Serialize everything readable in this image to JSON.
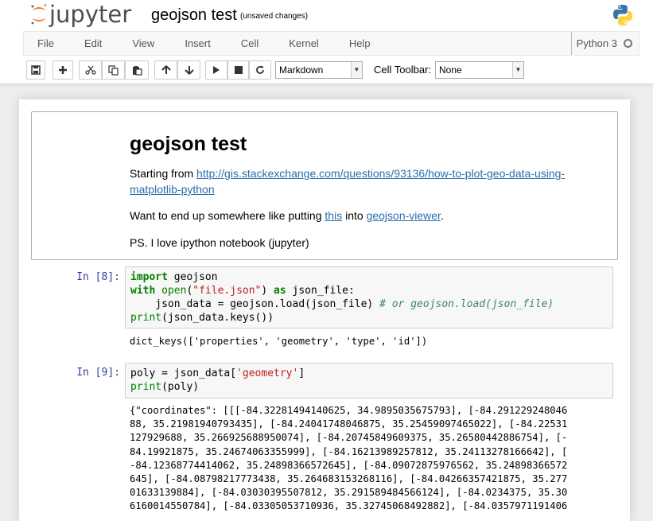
{
  "header": {
    "logo_text": "jupyter",
    "notebook_name": "geojson test",
    "save_status": "(unsaved changes)"
  },
  "menu": {
    "items": [
      "File",
      "Edit",
      "View",
      "Insert",
      "Cell",
      "Kernel",
      "Help"
    ],
    "kernel_name": "Python 3"
  },
  "toolbar": {
    "cell_type": "Markdown",
    "cell_toolbar_label": "Cell Toolbar:",
    "cell_toolbar_value": "None"
  },
  "markdown_cell": {
    "title": "geojson test",
    "p1_prefix": "Starting from ",
    "p1_link_line1": "http://gis.stackexchange.com/questions/93136/how-to-plot-geo-data-using-",
    "p1_link_line2": "matplotlib-python",
    "p2_prefix": "Want to end up somewhere like putting ",
    "p2_link1": "this",
    "p2_mid": " into ",
    "p2_link2": "geojson-viewer",
    "p2_suffix": ".",
    "p3": "PS. I love ipython notebook (jupyter)"
  },
  "cells": [
    {
      "prompt": "In [8]:",
      "output": "dict_keys(['properties', 'geometry', 'type', 'id'])"
    },
    {
      "prompt": "In [9]:",
      "output_lines": [
        "{\"coordinates\": [[[-84.32281494140625, 34.9895035675793], [-84.291229248046",
        "88, 35.21981940793435], [-84.24041748046875, 35.25459097465022], [-84.22531",
        "127929688, 35.266925688950074], [-84.20745849609375, 35.26580442886754], [-",
        "84.19921875, 35.24674063355999], [-84.16213989257812, 35.24113278166642], [",
        "-84.12368774414062, 35.24898366572645], [-84.09072875976562, 35.24898366572",
        "645], [-84.08798217773438, 35.264683153268116], [-84.04266357421875, 35.277",
        "01633139884], [-84.03030395507812, 35.291589484566124], [-84.0234375, 35.30",
        "6160014550784], [-84.03305053710936, 35.32745068492882], [-84.0357971191406"
      ]
    }
  ],
  "code": {
    "c8_l1_kw": "import",
    "c8_l1_rest": " geojson",
    "c8_l2_kw": "with",
    "c8_l2_bi": "open",
    "c8_l2_p1": "(",
    "c8_l2_str": "\"file.json\"",
    "c8_l2_p2": ") ",
    "c8_l2_as": "as",
    "c8_l2_rest": " json_file:",
    "c8_l3_code": "    json_data = geojson.load(json_file) ",
    "c8_l3_comment": "# or geojson.load(json_file)",
    "c8_l4_bi": "print",
    "c8_l4_rest": "(json_data.keys())",
    "c9_l1_a": "poly = json_data[",
    "c9_l1_str": "'geometry'",
    "c9_l1_b": "]",
    "c9_l2_bi": "print",
    "c9_l2_rest": "(poly)"
  }
}
